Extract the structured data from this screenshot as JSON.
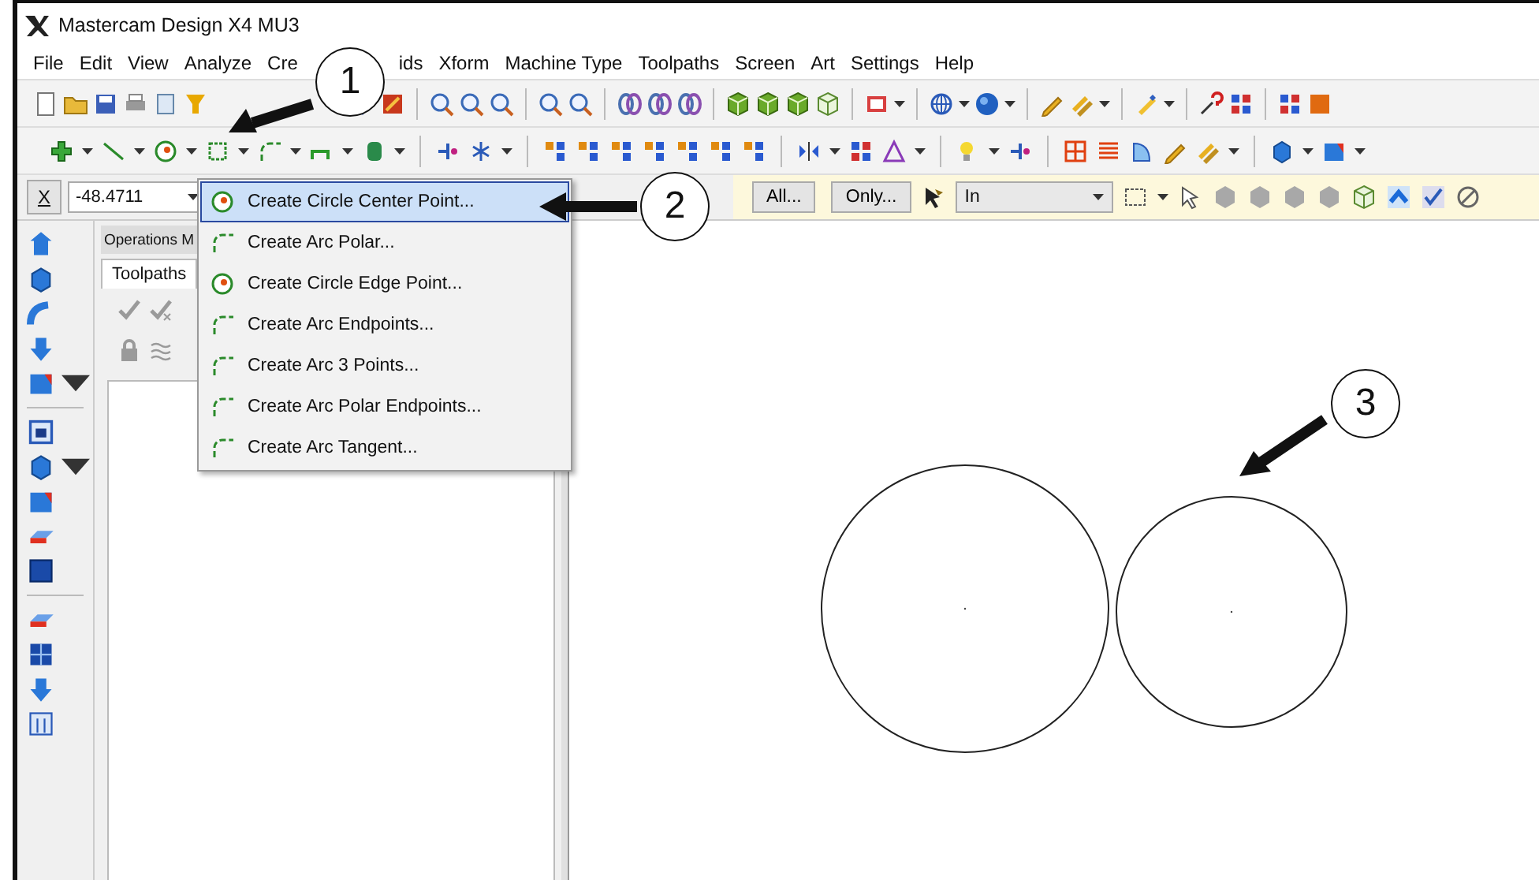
{
  "window": {
    "title": "Mastercam Design X4 MU3"
  },
  "menu_bar": [
    {
      "label": "File"
    },
    {
      "label": "Edit"
    },
    {
      "label": "View"
    },
    {
      "label": "Analyze"
    },
    {
      "label": "Cre"
    },
    {
      "label": "ids"
    },
    {
      "label": "Xform"
    },
    {
      "label": "Machine Type"
    },
    {
      "label": "Toolpaths"
    },
    {
      "label": "Screen"
    },
    {
      "label": "Art"
    },
    {
      "label": "Settings"
    },
    {
      "label": "Help"
    }
  ],
  "selection_bar": {
    "coordinate_label": "X",
    "coordinate_value": "-48.4711",
    "buttons": [
      "All...",
      "Only..."
    ],
    "mask_mode": "In"
  },
  "dropdown_menu": [
    {
      "label": "Create Circle Center Point...",
      "selected": true
    },
    {
      "label": "Create Arc Polar...",
      "selected": false
    },
    {
      "label": "Create Circle Edge Point...",
      "selected": false
    },
    {
      "label": "Create Arc Endpoints...",
      "selected": false
    },
    {
      "label": "Create Arc 3 Points...",
      "selected": false
    },
    {
      "label": "Create Arc Polar Endpoints...",
      "selected": false
    },
    {
      "label": "Create Arc Tangent...",
      "selected": false
    }
  ],
  "operations_manager": {
    "title": "Operations M",
    "tabs": [
      {
        "label": "Toolpaths",
        "selected": true
      }
    ]
  },
  "callouts": [
    {
      "number": "1"
    },
    {
      "number": "2"
    },
    {
      "number": "3"
    }
  ]
}
